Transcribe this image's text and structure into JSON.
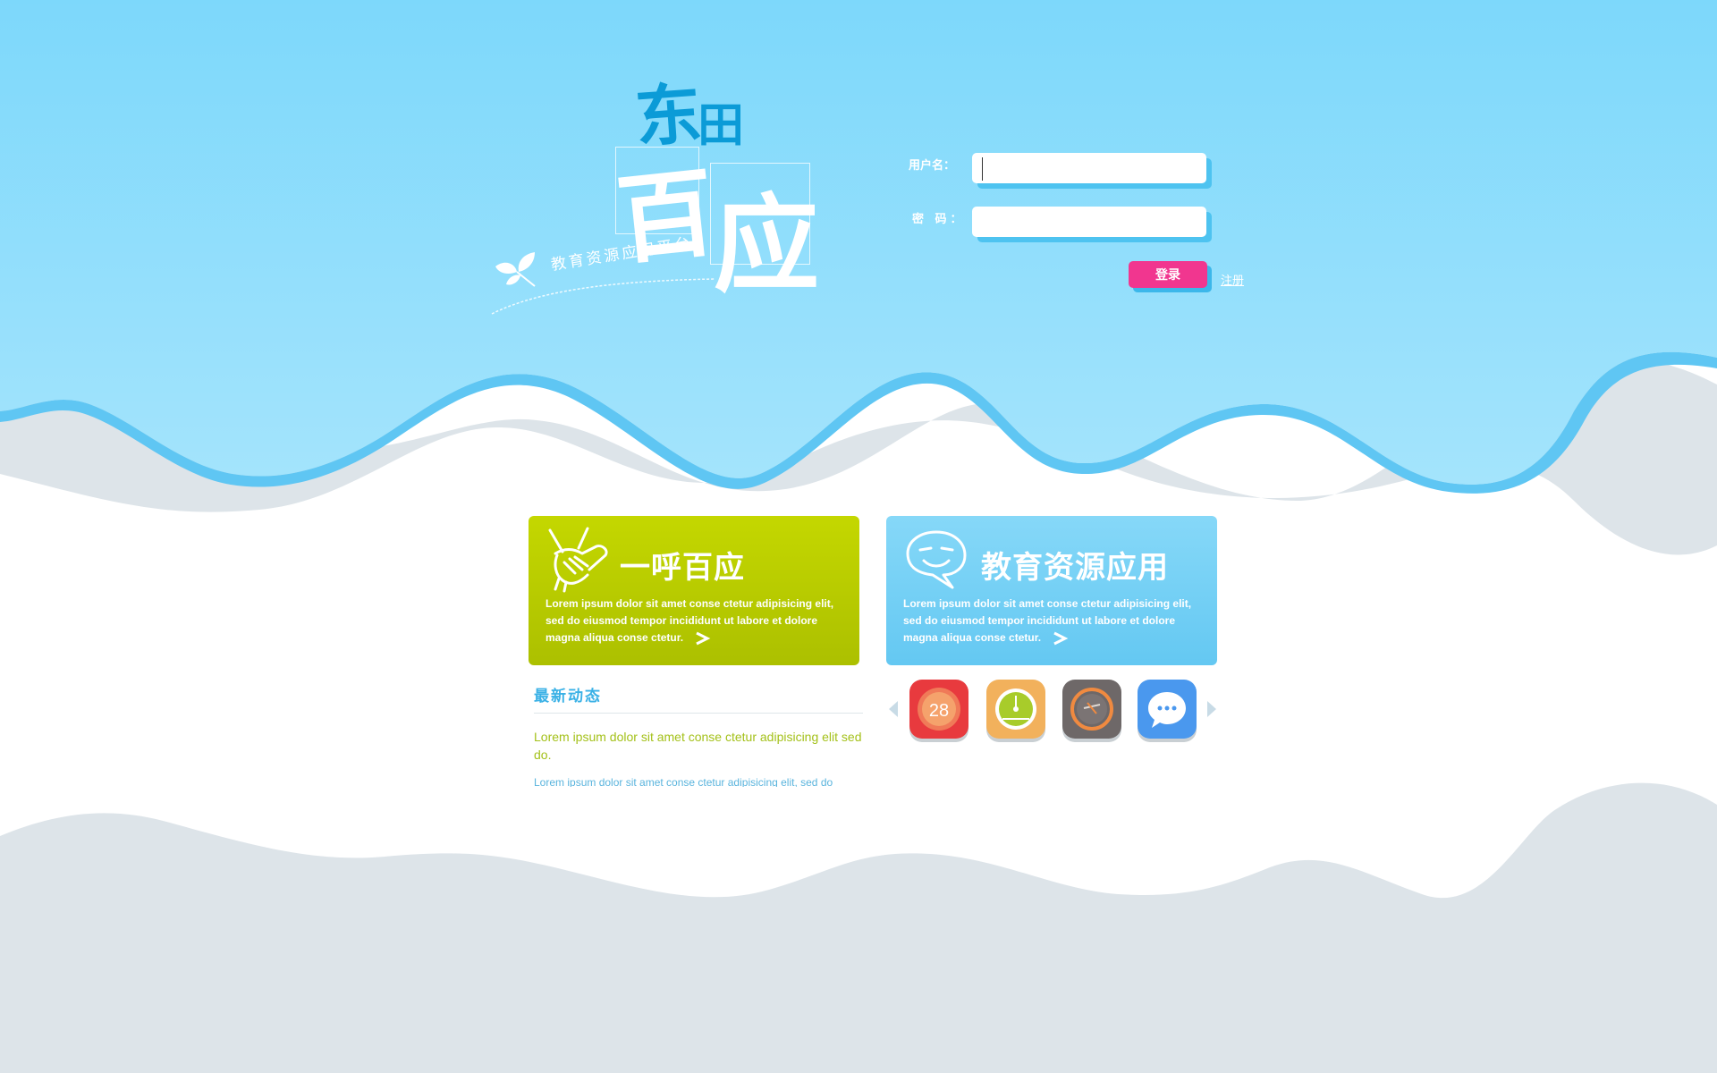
{
  "colors": {
    "sky_top": "#7fd8fb",
    "sky_bottom": "#9ee2fb",
    "wave_blue": "#63c8f3",
    "wave_gray": "#dde4e9",
    "login_pink": "#f1368f",
    "card_green": "#b8cc00",
    "card_blue": "#75cff5"
  },
  "logo": {
    "line1a": "东",
    "line1b": "田",
    "line2a": "百",
    "line2b": "应",
    "slogan": "教育资源应用平台",
    "leaf_icon": "leaf-icon"
  },
  "login": {
    "username_label": "用户名：",
    "username_value": "",
    "password_label": "密 码：",
    "password_value": "",
    "submit_label": "登录",
    "register_label": "注册"
  },
  "cards": {
    "green": {
      "title": "一呼百应",
      "description": "Lorem ipsum dolor sit amet conse ctetur adipisicing elit, sed do eiusmod tempor incididunt ut labore et dolore magna aliqua conse ctetur.",
      "icon": "handshake-icon"
    },
    "blue": {
      "title": "教育资源应用",
      "description": "Lorem ipsum dolor sit amet conse ctetur adipisicing elit, sed do eiusmod tempor incididunt ut labore et dolore magna aliqua conse ctetur.",
      "icon": "chat-face-icon"
    }
  },
  "news": {
    "title": "最新动态",
    "item1": "Lorem ipsum dolor sit amet conse ctetur adipisicing elit sed do.",
    "item2": "Lorem ipsum dolor sit amet conse ctetur adipisicing elit, sed do"
  },
  "apps": {
    "calendar_number": "28",
    "items": [
      "calendar-icon",
      "gauge-icon",
      "dial-icon",
      "message-icon"
    ]
  }
}
